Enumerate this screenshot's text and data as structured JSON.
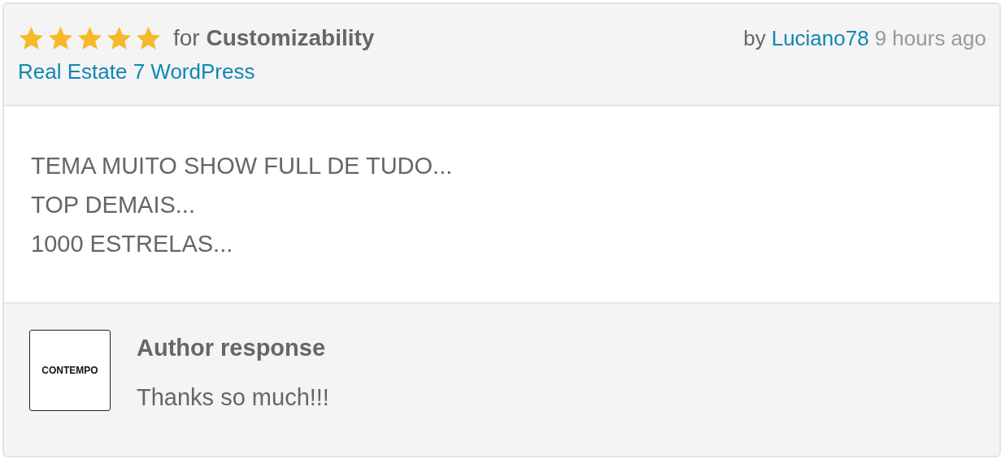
{
  "review": {
    "stars": 5,
    "rating_for": "for **Customizability**",
    "product": "Real Estate 7 WordPress",
    "by": "by",
    "author": "Luciano78",
    "time": "9 hours ago",
    "body": [
      "TEMA MUITO SHOW FULL DE TUDO...",
      "TOP DEMAIS...",
      "1000 ESTRELAS..."
    ]
  },
  "response": {
    "logo": "CONTEMPO",
    "title": "Author response",
    "text": "Thanks so much!!!"
  }
}
